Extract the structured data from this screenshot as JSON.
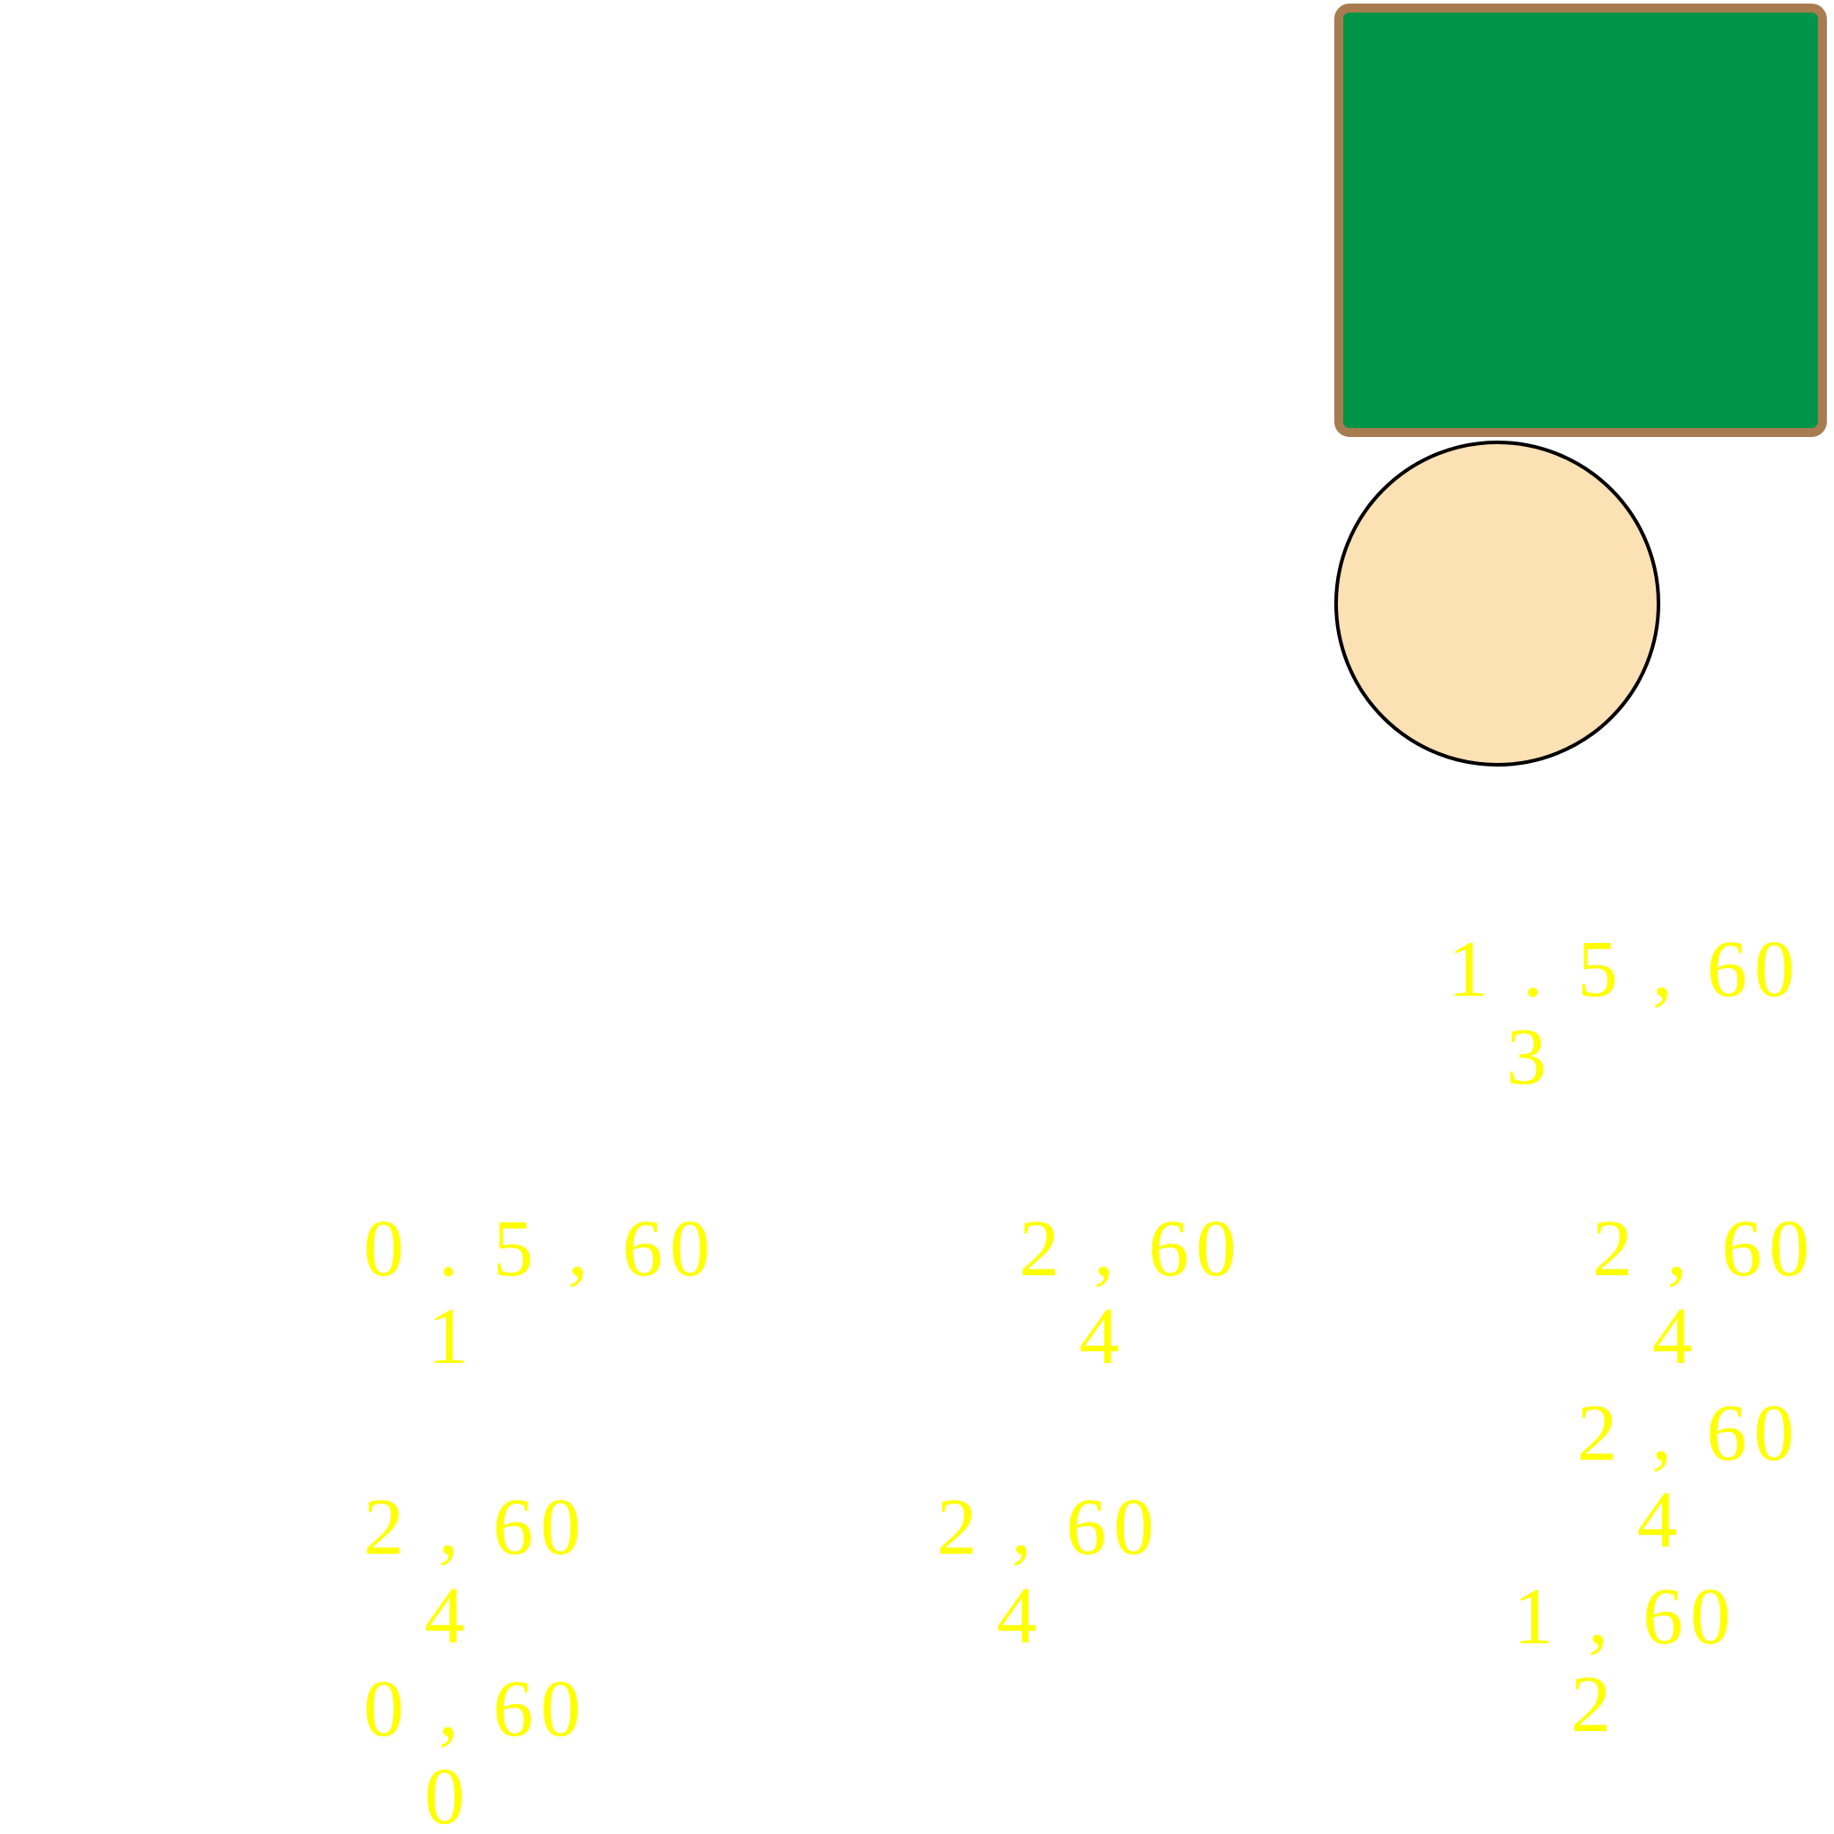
{
  "colors": {
    "rect_fill": "#009448",
    "rect_stroke": "#A87C50",
    "circle_fill": "#FCE1B4",
    "circle_stroke": "#000000",
    "label": "#FFFF00"
  },
  "shapes": {
    "rectangle": {
      "kind": "rounded-rectangle",
      "fill_name": "green",
      "border_name": "brown"
    },
    "circle": {
      "kind": "circle",
      "fill_name": "peach"
    }
  },
  "labels": [
    {
      "id": "label-a",
      "top": "1 . 5 , 60",
      "bottom": "3"
    },
    {
      "id": "label-b",
      "top": "0 . 5 , 60",
      "bottom": "1"
    },
    {
      "id": "label-c",
      "top": "2 , 60",
      "bottom": "4"
    },
    {
      "id": "label-d",
      "top": "2 , 60",
      "bottom": "4"
    },
    {
      "id": "label-e",
      "top": "2 , 60",
      "bottom": "4"
    },
    {
      "id": "label-f",
      "top": "2 , 60",
      "bottom": "4"
    },
    {
      "id": "label-g",
      "top": "2 , 60",
      "bottom": "4"
    },
    {
      "id": "label-h",
      "top": "1 , 60",
      "bottom": "2"
    },
    {
      "id": "label-i",
      "top": "0 , 60",
      "bottom": "0"
    }
  ]
}
